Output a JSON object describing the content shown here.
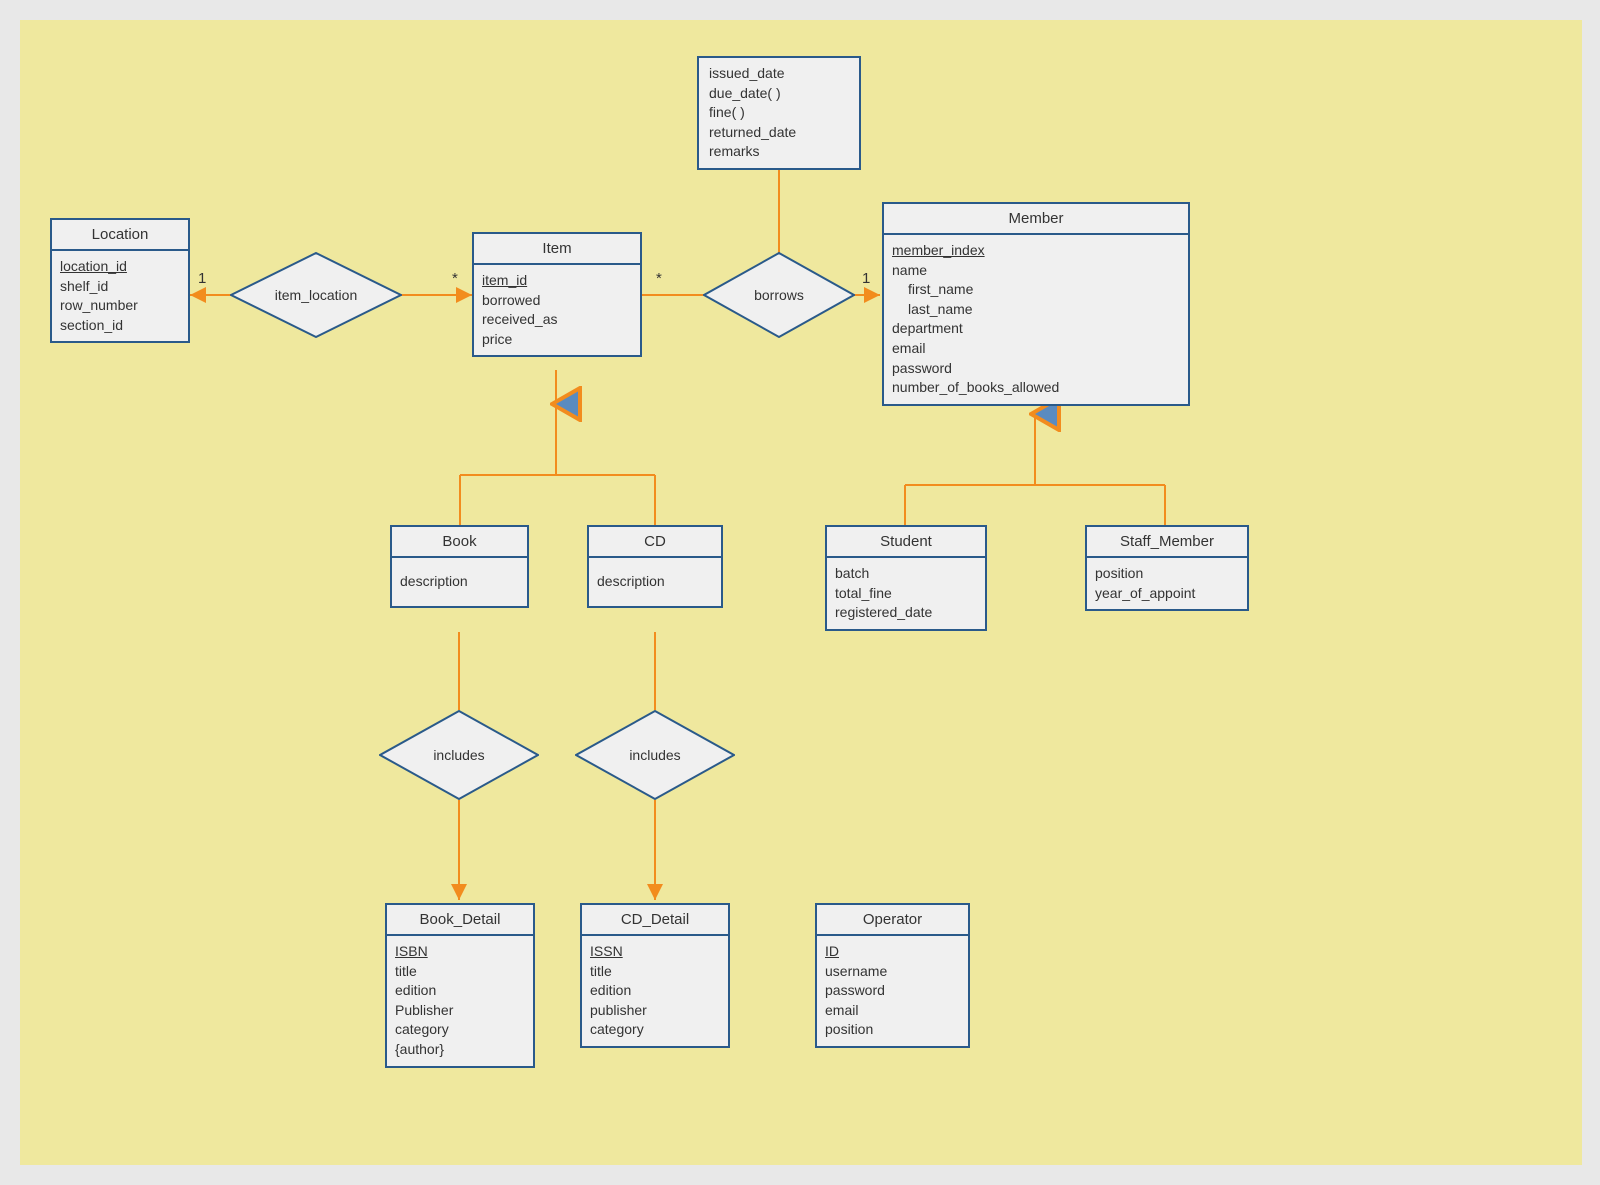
{
  "entities": {
    "location": {
      "title": "Location",
      "attrs": [
        "location_id",
        "shelf_id",
        "row_number",
        "section_id"
      ],
      "key": "location_id"
    },
    "item": {
      "title": "Item",
      "attrs": [
        "item_id",
        "borrowed",
        "received_as",
        "price"
      ],
      "key": "item_id"
    },
    "member": {
      "title": "Member",
      "attrs": [
        "member_index",
        "name",
        "first_name",
        "last_name",
        "department",
        "email",
        "password",
        "number_of_books_allowed"
      ],
      "key": "member_index",
      "indented": [
        "first_name",
        "last_name"
      ]
    },
    "book": {
      "title": "Book",
      "attrs": [
        "description"
      ]
    },
    "cd": {
      "title": "CD",
      "attrs": [
        "description"
      ]
    },
    "student": {
      "title": "Student",
      "attrs": [
        "batch",
        "total_fine",
        "registered_date"
      ]
    },
    "staff_member": {
      "title": "Staff_Member",
      "attrs": [
        "position",
        "year_of_appoint"
      ]
    },
    "book_detail": {
      "title": "Book_Detail",
      "attrs": [
        "ISBN",
        "title",
        "edition",
        "Publisher",
        "category",
        "{author}"
      ],
      "key": "ISBN"
    },
    "cd_detail": {
      "title": "CD_Detail",
      "attrs": [
        "ISSN",
        "title",
        "edition",
        "publisher",
        "category"
      ],
      "key": "ISSN"
    },
    "operator": {
      "title": "Operator",
      "attrs": [
        "ID",
        "username",
        "password",
        "email",
        "position"
      ],
      "key": "ID"
    }
  },
  "relationships": {
    "item_location": {
      "label": "item_location",
      "card_left": "1",
      "card_right": "*"
    },
    "borrows": {
      "label": "borrows",
      "card_left": "*",
      "card_right": "1"
    },
    "includes_book": {
      "label": "includes"
    },
    "includes_cd": {
      "label": "includes"
    }
  },
  "borrows_attrs": {
    "lines": [
      "issued_date",
      "due_date( )",
      "fine( )",
      "returned_date",
      "remarks"
    ]
  },
  "colors": {
    "border": "#2a5a8a",
    "line": "#f28c1e",
    "bg": "#efe89e",
    "box": "#f0f0f0"
  }
}
